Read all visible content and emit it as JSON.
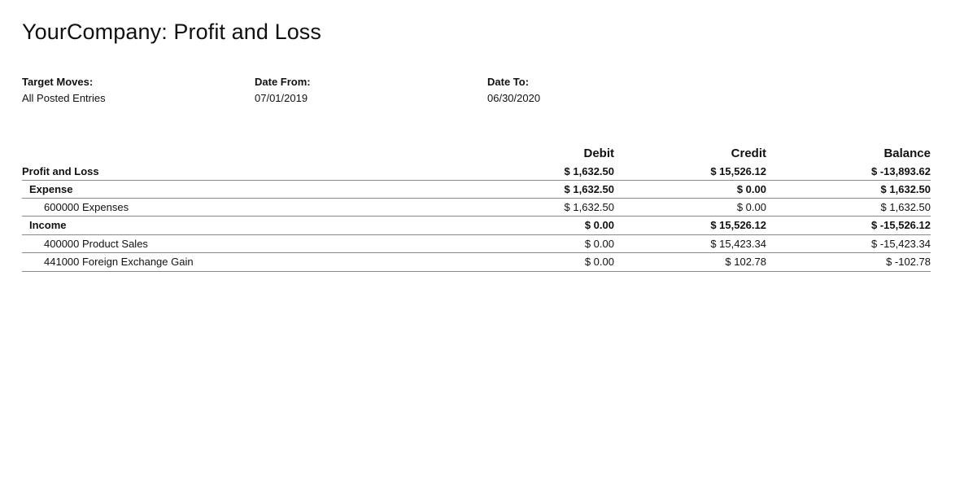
{
  "report": {
    "title": "YourCompany: Profit and Loss",
    "filters": [
      {
        "label": "Target Moves:",
        "value": "All Posted Entries"
      },
      {
        "label": "Date From:",
        "value": "07/01/2019"
      },
      {
        "label": "Date To:",
        "value": "06/30/2020"
      }
    ],
    "columns": {
      "name": "",
      "debit": "Debit",
      "credit": "Credit",
      "balance": "Balance"
    },
    "rows": [
      {
        "name": "Profit and Loss",
        "debit": "$ 1,632.50",
        "credit": "$ 15,526.12",
        "balance": "$ -13,893.62"
      },
      {
        "name": "Expense",
        "debit": "$ 1,632.50",
        "credit": "$ 0.00",
        "balance": "$ 1,632.50"
      },
      {
        "name": "600000 Expenses",
        "debit": "$ 1,632.50",
        "credit": "$ 0.00",
        "balance": "$ 1,632.50"
      },
      {
        "name": "Income",
        "debit": "$ 0.00",
        "credit": "$ 15,526.12",
        "balance": "$ -15,526.12"
      },
      {
        "name": "400000 Product Sales",
        "debit": "$ 0.00",
        "credit": "$ 15,423.34",
        "balance": "$ -15,423.34"
      },
      {
        "name": "441000 Foreign Exchange Gain",
        "debit": "$ 0.00",
        "credit": "$ 102.78",
        "balance": "$ -102.78"
      }
    ]
  }
}
